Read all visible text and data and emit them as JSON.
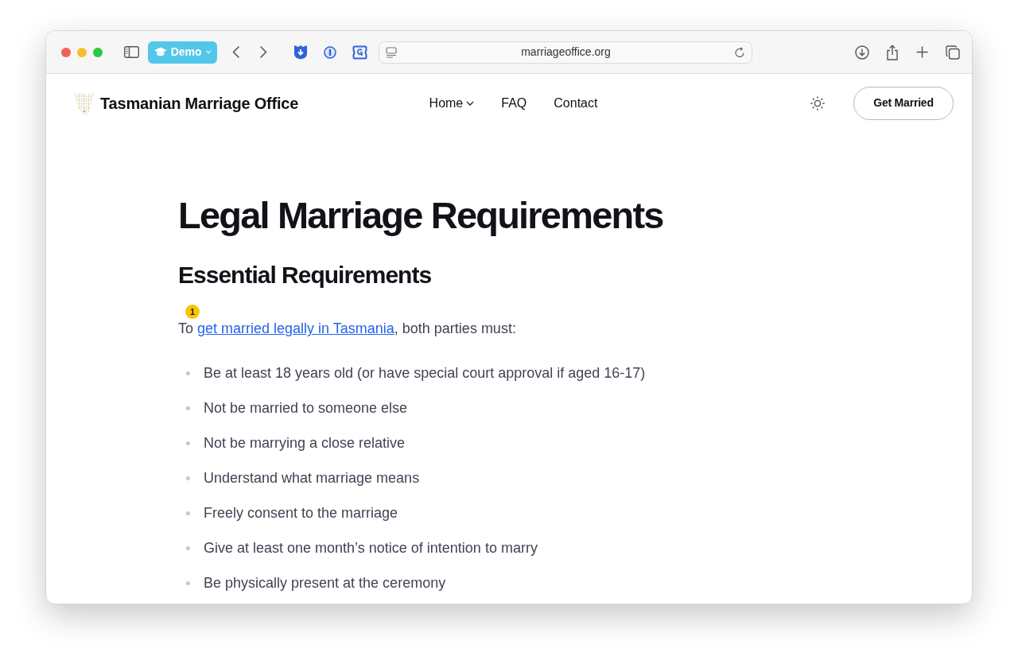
{
  "browser": {
    "profile_label": "Demo",
    "url": "marriageoffice.org"
  },
  "site_header": {
    "title": "Tasmanian Marriage Office",
    "nav": [
      {
        "label": "Home",
        "dropdown": true
      },
      {
        "label": "FAQ",
        "dropdown": false
      },
      {
        "label": "Contact",
        "dropdown": false
      }
    ],
    "cta": "Get Married"
  },
  "article": {
    "title": "Legal Marriage Requirements",
    "section_heading": "Essential Requirements",
    "marker": "1",
    "intro": {
      "before": "To ",
      "link": "get married legally in Tasmania",
      "after": ", both parties must:"
    },
    "requirements": [
      "Be at least 18 years old (or have special court approval if aged 16-17)",
      "Not be married to someone else",
      "Not be marrying a close relative",
      "Understand what marriage means",
      "Freely consent to the marriage",
      "Give at least one month’s notice of intention to marry",
      "Be physically present at the ceremony"
    ]
  }
}
